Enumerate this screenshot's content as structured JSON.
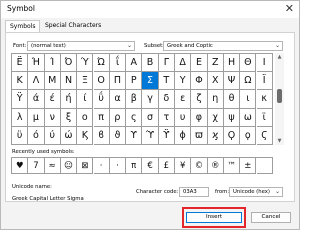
{
  "window": {
    "title": "Symbol",
    "close_icon": "close-icon"
  },
  "tabs": [
    {
      "label": "Symbols",
      "selected": true
    },
    {
      "label": "Special Characters",
      "selected": false
    }
  ],
  "font": {
    "label": "Font:",
    "value": "(normal text)"
  },
  "subset": {
    "label": "Subset:",
    "value": "Greek and Coptic"
  },
  "symbol_rows": [
    [
      "Ë",
      "Ή",
      "Ί",
      "Ό",
      "Ύ",
      "Ώ",
      "ΐ",
      "Α",
      "Β",
      "Γ",
      "Δ",
      "Ε",
      "Ζ",
      "Η",
      "Θ",
      "Ι"
    ],
    [
      "Κ",
      "Λ",
      "Μ",
      "Ν",
      "Ξ",
      "Ο",
      "Π",
      "Ρ",
      "Σ",
      "Τ",
      "Υ",
      "Φ",
      "Χ",
      "Ψ",
      "Ω",
      "Ϊ"
    ],
    [
      "Ϋ",
      "ά",
      "έ",
      "ή",
      "ί",
      "ΰ",
      "α",
      "β",
      "γ",
      "δ",
      "ε",
      "ζ",
      "η",
      "θ",
      "ι",
      "κ"
    ],
    [
      "λ",
      "μ",
      "ν",
      "ξ",
      "ο",
      "π",
      "ρ",
      "ς",
      "σ",
      "τ",
      "υ",
      "φ",
      "χ",
      "ψ",
      "ω",
      "ϊ"
    ],
    [
      "ϋ",
      "ό",
      "ύ",
      "ώ",
      "Ϗ",
      "ϐ",
      "ϑ",
      "ϒ",
      "ϓ",
      "ϔ",
      "ϕ",
      "ϖ",
      "ϗ",
      "Ϙ",
      "ϙ",
      "Ϛ"
    ]
  ],
  "selected_symbol": {
    "row": 1,
    "col": 8
  },
  "recent": {
    "label": "Recently used symbols:",
    "symbols": [
      "♥",
      "7",
      "≈",
      "☺",
      "⊠",
      "·",
      "·",
      "π",
      "€",
      "£",
      "¥",
      "©",
      "®",
      "™",
      "±",
      ""
    ]
  },
  "unicode_name": {
    "label": "Unicode name:",
    "value": "Greek Capital Letter Sigma"
  },
  "character_code": {
    "label": "Character code:",
    "value": "03A3"
  },
  "from": {
    "label": "from:",
    "value": "Unicode (hex)"
  },
  "buttons": {
    "insert": "Insert",
    "cancel": "Cancel"
  },
  "colors": {
    "accent": "#0078d7",
    "highlight": "#e3262c"
  }
}
